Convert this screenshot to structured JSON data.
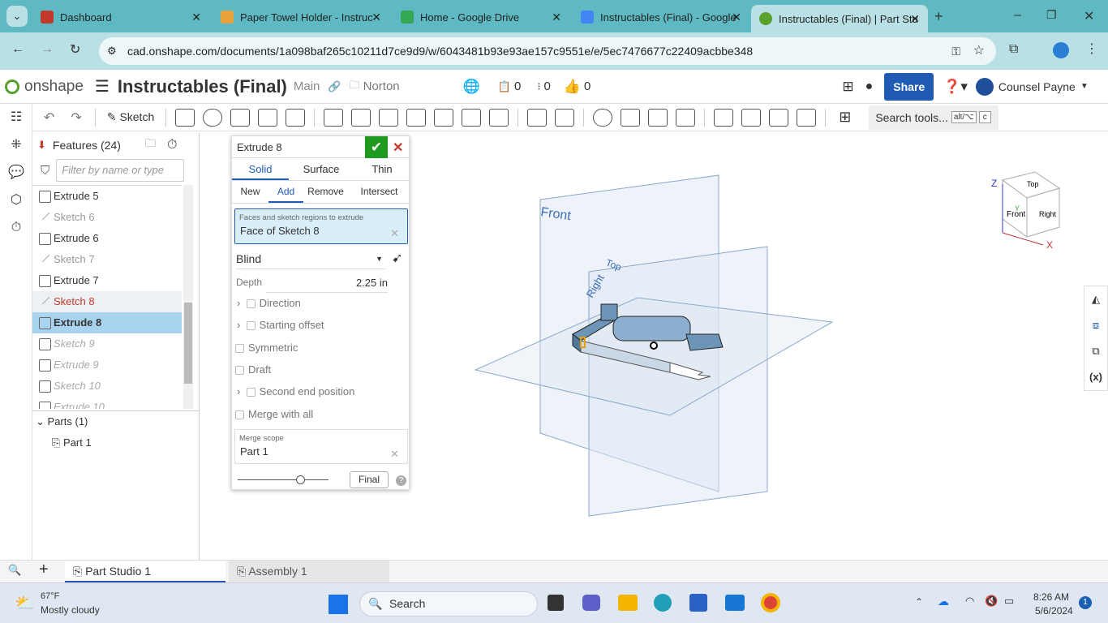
{
  "browser": {
    "tabs": [
      {
        "label": "Dashboard",
        "color": "#c0392b"
      },
      {
        "label": "Paper Towel Holder - Instruc",
        "color": "#e6a23c"
      },
      {
        "label": "Home - Google Drive",
        "color": "#34a853"
      },
      {
        "label": "Instructables (Final) - Google",
        "color": "#4285f4"
      },
      {
        "label": "Instructables (Final) | Part Stu",
        "color": "#5aa02c"
      }
    ],
    "url": "cad.onshape.com/documents/1a098baf265c10211d7ce9d9/w/6043481b93e93ae157c9551e/e/5ec7476677c22409acbbe348"
  },
  "app": {
    "logo": "onshape",
    "doc_title": "Instructables (Final)",
    "branch": "Main",
    "folder": "Norton",
    "counts": [
      "0",
      "0",
      "0"
    ],
    "share": "Share",
    "user": "Counsel Payne",
    "accent": "#1f5bb5"
  },
  "toolbar": {
    "sketch": "Sketch",
    "search": "Search tools...",
    "shortcut1": "alt/⌥",
    "shortcut2": "c"
  },
  "features": {
    "header": "Features (24)",
    "filter_placeholder": "Filter by name or type",
    "items": [
      {
        "label": "Extrude 5",
        "kind": "ex"
      },
      {
        "label": "Sketch 6",
        "kind": "sk"
      },
      {
        "label": "Extrude 6",
        "kind": "ex"
      },
      {
        "label": "Sketch 7",
        "kind": "sk"
      },
      {
        "label": "Extrude 7",
        "kind": "ex"
      },
      {
        "label": "Sketch 8",
        "kind": "red"
      },
      {
        "label": "Extrude 8",
        "kind": "sel"
      },
      {
        "label": "Sketch 9",
        "kind": "it"
      },
      {
        "label": "Extrude 9",
        "kind": "it"
      },
      {
        "label": "Sketch 10",
        "kind": "it"
      },
      {
        "label": "Extrude 10",
        "kind": "it"
      }
    ],
    "parts_header": "Parts (1)",
    "parts": [
      "Part 1"
    ]
  },
  "dialog": {
    "title": "Extrude 8",
    "tabs1": [
      "Solid",
      "Surface",
      "Thin"
    ],
    "tabs2": [
      "New",
      "Add",
      "Remove",
      "Intersect"
    ],
    "faces_label": "Faces and sketch regions to extrude",
    "faces_value": "Face of Sketch 8",
    "end_type": "Blind",
    "depth_label": "Depth",
    "depth_value": "2.25 in",
    "direction": "Direction",
    "starting_offset": "Starting offset",
    "symmetric": "Symmetric",
    "draft": "Draft",
    "second_end": "Second end position",
    "merge_all": "Merge with all",
    "merge_scope_label": "Merge scope",
    "merge_scope_value": "Part 1",
    "final": "Final"
  },
  "viewport": {
    "planes": [
      "Front",
      "Top",
      "Right"
    ],
    "cube": {
      "front": "Front",
      "top": "Top",
      "right": "Right",
      "z": "Z",
      "x": "X",
      "y": "Y"
    }
  },
  "tabs_bottom": [
    "Part Studio 1",
    "Assembly 1"
  ],
  "taskbar": {
    "temp": "67°F",
    "weather": "Mostly cloudy",
    "search": "Search",
    "time": "8:26 AM",
    "date": "5/6/2024",
    "notif": "1"
  }
}
